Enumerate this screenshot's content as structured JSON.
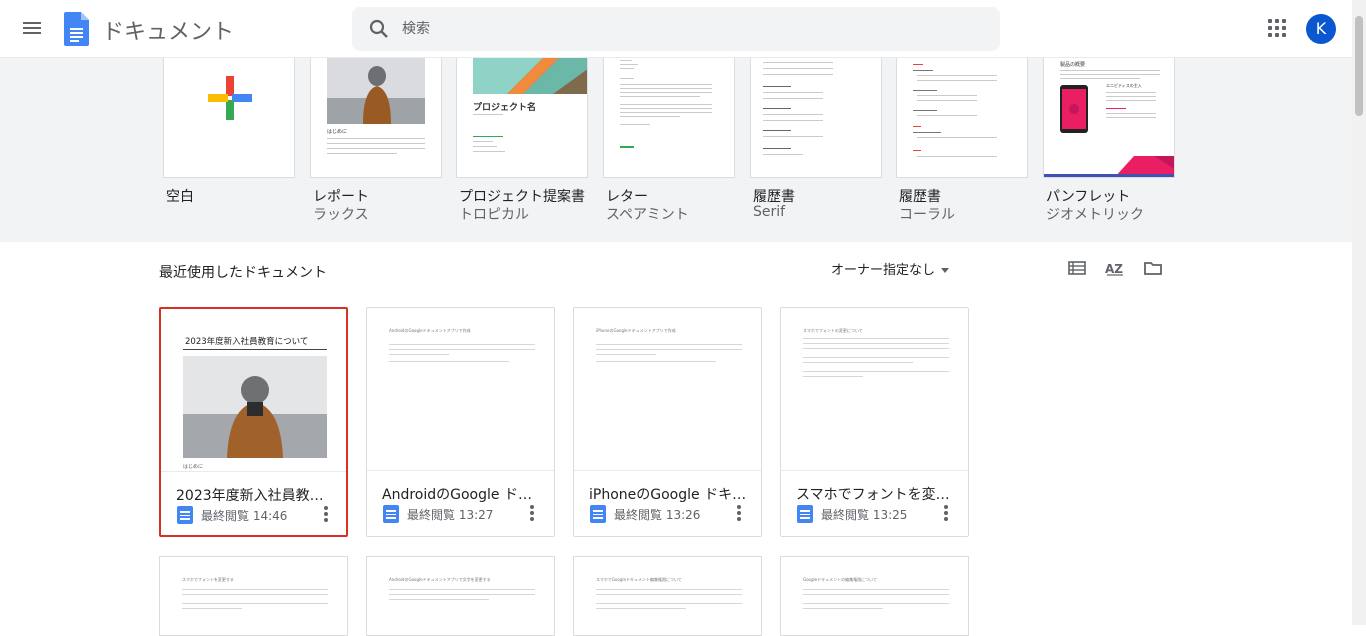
{
  "header": {
    "app_title": "ドキュメント",
    "search_placeholder": "検索",
    "avatar_letter": "K"
  },
  "templates": [
    {
      "name": "空白",
      "sub": ""
    },
    {
      "name": "レポート",
      "sub": "ラックス",
      "doc_heading": "はじめに"
    },
    {
      "name": "プロジェクト提案書",
      "sub": "トロピカル",
      "doc_heading": "プロジェクト名"
    },
    {
      "name": "レター",
      "sub": "スペアミント"
    },
    {
      "name": "履歴書",
      "sub": "Serif"
    },
    {
      "name": "履歴書",
      "sub": "コーラル"
    },
    {
      "name": "パンフレット",
      "sub": "ジオメトリック",
      "doc_heading": "製品の概要",
      "doc_sub": "エニピティスの主入"
    }
  ],
  "recent": {
    "title": "最近使用したドキュメント",
    "owner_filter": "オーナー指定なし"
  },
  "documents": [
    {
      "title": "2023年度新入社員教育に...",
      "meta": "最終閲覧 14:46",
      "preview_heading": "2023年度新入社員教育について",
      "preview_caption": "はじめに"
    },
    {
      "title": "AndroidのGoogle ドキュ...",
      "meta": "最終閲覧 13:27",
      "preview_heading": "AndroidのGoogleドキュメントアプリで作成"
    },
    {
      "title": "iPhoneのGoogle ドキュメ...",
      "meta": "最終閲覧 13:26",
      "preview_heading": "iPhoneのGoogleドキュメントアプリで作成"
    },
    {
      "title": "スマホでフォントを変更す...",
      "meta": "最終閲覧 13:25",
      "preview_heading": "スマホでフォントの変更について"
    }
  ],
  "documents_row2": [
    {
      "preview_heading": "スマホでフォントを変更する"
    },
    {
      "preview_heading": "AndroidのGoogleドキュメントアプリで文字を変更する"
    },
    {
      "preview_heading": "スマホでGoogleドキュメント編集権限について"
    },
    {
      "preview_heading": "Googleドキュメントの編集権限について"
    }
  ],
  "colors": {
    "accent_blue": "#4285f4",
    "selected_border": "#d93025",
    "avatar_bg": "#0b57d0"
  }
}
